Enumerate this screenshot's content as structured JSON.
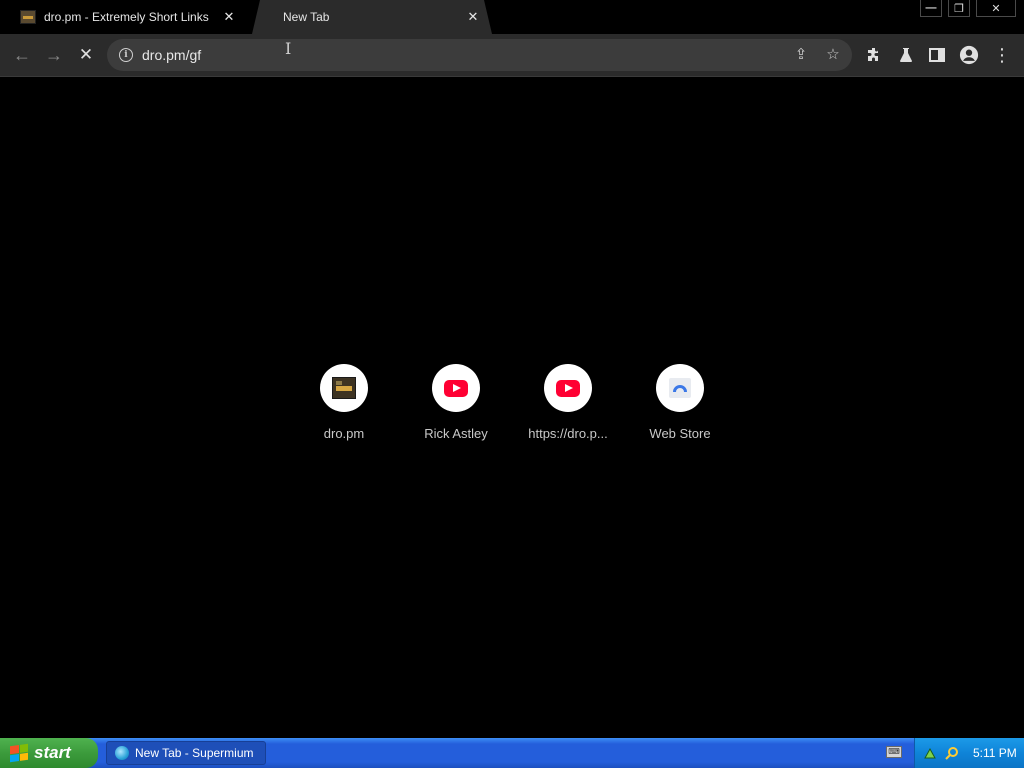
{
  "tabs": [
    {
      "title": "dro.pm - Extremely Short Links",
      "close": "✕"
    },
    {
      "title": "New Tab",
      "close": "✕"
    }
  ],
  "window_controls": {
    "minimize": "—",
    "restore": "❐",
    "close": "✕"
  },
  "toolbar": {
    "back": "←",
    "forward": "→",
    "stop": "✕",
    "url": "dro.pm/gf",
    "info": "i",
    "share": "⇪",
    "bookmark": "☆",
    "extensions": "✚",
    "labs": "▲",
    "side_panel": "◧",
    "profile": "●",
    "menu": "⋮"
  },
  "shortcuts": [
    {
      "label": "dro.pm",
      "icon": "dro-pm-favicon"
    },
    {
      "label": "Rick Astley",
      "icon": "youtube-icon"
    },
    {
      "label": "https://dro.p...",
      "icon": "youtube-icon"
    },
    {
      "label": "Web Store",
      "icon": "web-store-icon"
    }
  ],
  "taskbar": {
    "start_label": "start",
    "task_label": "New Tab - Supermium",
    "clock": "5:11 PM"
  },
  "colors": {
    "youtube": "#ff0033",
    "xp_taskbar": "#245edb",
    "xp_start": "#3c9b3c",
    "xp_tray": "#0f84d8"
  }
}
